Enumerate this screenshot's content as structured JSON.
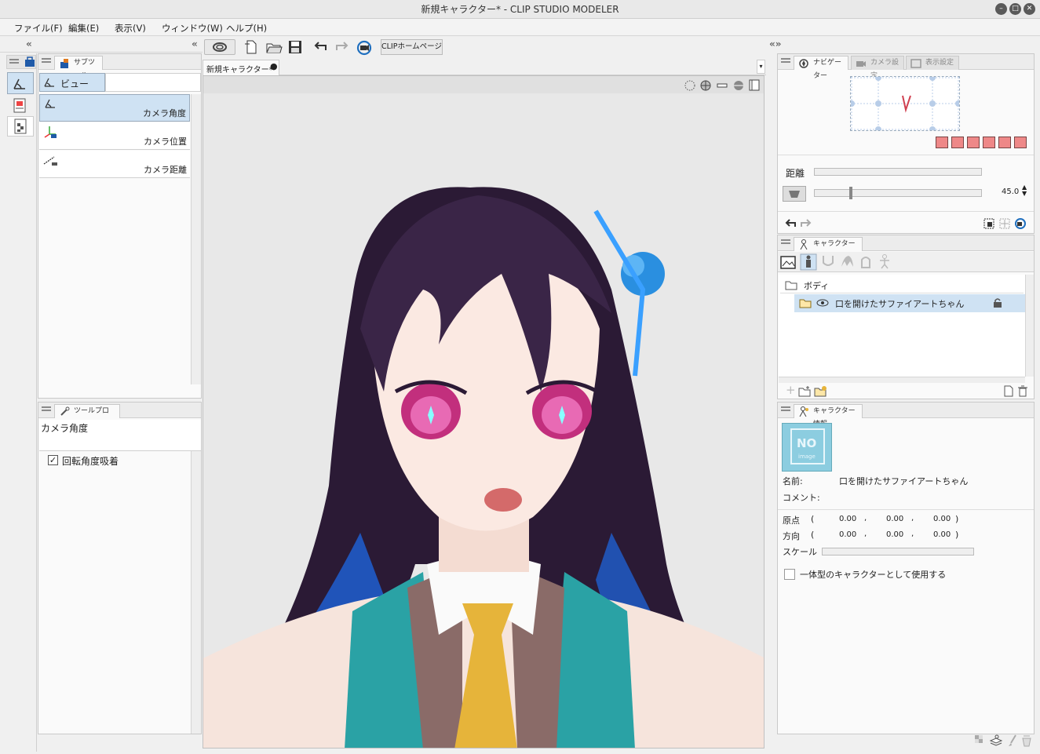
{
  "window": {
    "title": "新規キャラクター* - CLIP STUDIO MODELER",
    "minimize_icon": "minimize-icon",
    "maximize_icon": "maximize-icon",
    "close_icon": "close-icon"
  },
  "menu": [
    "ファイル(F)",
    "編集(E)",
    "表示(V)",
    "ウィンドウ(W)",
    "ヘルプ(H)"
  ],
  "toolbar": {
    "clip_home_label": "CLIPホームページ"
  },
  "document_tab": {
    "label": "新規キャラクター*"
  },
  "subtool_panel": {
    "tab_label": "サブツール",
    "group_label": "ビュー",
    "items": [
      {
        "label": "カメラ角度",
        "selected": true
      },
      {
        "label": "カメラ位置",
        "selected": false
      },
      {
        "label": "カメラ距離",
        "selected": false
      }
    ]
  },
  "tool_property": {
    "tab_label": "ツールプロパティ",
    "title": "カメラ角度",
    "checkbox_label": "回転角度吸着",
    "checked": true
  },
  "navigator": {
    "tabs": [
      "ナビゲーター",
      "カメラ設定",
      "表示設定"
    ],
    "distance_label": "距離",
    "angle_value": "45.0"
  },
  "character_structure": {
    "tab_label": "キャラクター構成",
    "tree": [
      {
        "label": "ボディ"
      },
      {
        "label": "口を開けたサファイアートちゃん"
      }
    ]
  },
  "character_info": {
    "tab_label": "キャラクター情報",
    "thumbnail_text_1": "NO",
    "thumbnail_text_2": "image",
    "name_label": "名前:",
    "name_value": "口を開けたサファイアートちゃん",
    "comment_label": "コメント:",
    "origin_label": "原点",
    "direction_label": "方向",
    "scale_label": "スケール",
    "origin": [
      "0.00",
      "0.00",
      "0.00"
    ],
    "direction": [
      "0.00",
      "0.00",
      "0.00"
    ],
    "paren_open": "(",
    "paren_close": ")",
    "comma": ",",
    "single_character_label": "一体型のキャラクターとして使用する"
  }
}
